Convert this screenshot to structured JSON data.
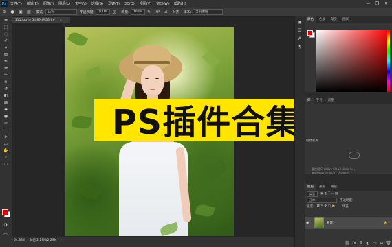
{
  "app": {
    "logo": "Ps"
  },
  "menu": [
    "文件(F)",
    "编辑(E)",
    "图像(I)",
    "图层(L)",
    "文字(Y)",
    "选择(S)",
    "滤镜(T)",
    "3D(D)",
    "视图(V)",
    "窗口(W)",
    "帮助(H)"
  ],
  "window_controls": [
    "—",
    "❐",
    "✕"
  ],
  "options_bar": {
    "mode_label": "模式:",
    "mode_value": "正常",
    "opacity_label": "不透明度:",
    "opacity_value": "100%",
    "flow_label": "流量:",
    "flow_value": "100%",
    "angle_value": "0°",
    "align_label": "对齐",
    "sample_label": "样本:",
    "sample_value": "当前图层"
  },
  "document": {
    "tab_title": "111.jpg @ 54.8%(RGB/8#)",
    "close_symbol": "×"
  },
  "banner": {
    "text": "PS插件合集"
  },
  "status": {
    "zoom": "54.88%",
    "doc_size": "文档:2.29M/2.29M"
  },
  "color_panel": {
    "tabs": [
      "颜色",
      "色板",
      "渐变",
      "图案"
    ]
  },
  "libraries_panel": {
    "tabs": [
      "库",
      "学习",
      "调整"
    ],
    "title": "创建新库",
    "message_line1": "要使用 Creative Cloud Libraries，",
    "message_line2": "需要登录 Creative Cloud账户。"
  },
  "layers_panel": {
    "tabs": [
      "图层",
      "通道",
      "路径"
    ],
    "kind_label": "类型",
    "blend_mode": "正常",
    "opacity_label": "不透明度:",
    "lock_label": "锁定:",
    "fill_label": "填充:",
    "layer_name": "背景"
  },
  "colors": {
    "foreground": "#e00000",
    "background": "#ffffff",
    "banner_bg": "#ffe500"
  },
  "tools": [
    "move-icon",
    "marquee-icon",
    "lasso-icon",
    "quick-select-icon",
    "crop-icon",
    "frame-icon",
    "eyedropper-icon",
    "healing-icon",
    "brush-icon",
    "stamp-icon",
    "history-brush-icon",
    "eraser-icon",
    "gradient-icon",
    "blur-icon",
    "dodge-icon",
    "pen-icon",
    "type-icon",
    "path-select-icon",
    "shape-icon",
    "hand-icon",
    "zoom-icon",
    "more-icon"
  ]
}
